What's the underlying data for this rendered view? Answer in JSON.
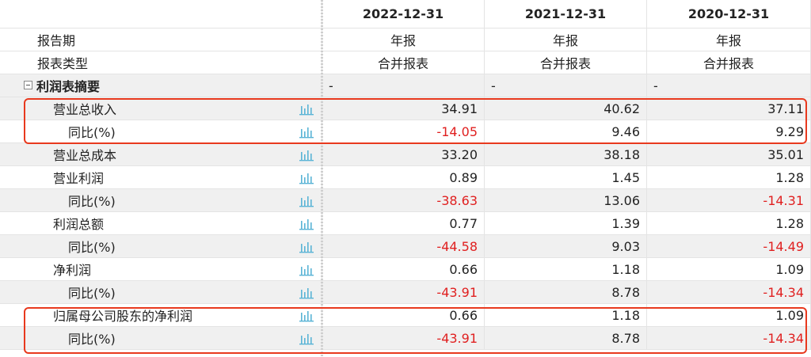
{
  "header": {
    "dates": [
      "2022-12-31",
      "2021-12-31",
      "2020-12-31"
    ]
  },
  "rows": [
    {
      "label": "报告期",
      "values": [
        "年报",
        "年报",
        "年报"
      ]
    },
    {
      "label": "报表类型",
      "values": [
        "合并报表",
        "合并报表",
        "合并报表"
      ]
    },
    {
      "label": "利润表摘要",
      "values": [
        "-",
        "-",
        "-"
      ]
    },
    {
      "label": "营业总收入",
      "values": [
        "34.91",
        "40.62",
        "37.11"
      ]
    },
    {
      "label": "同比(%)",
      "values": [
        "-14.05",
        "9.46",
        "9.29"
      ]
    },
    {
      "label": "营业总成本",
      "values": [
        "33.20",
        "38.18",
        "35.01"
      ]
    },
    {
      "label": "营业利润",
      "values": [
        "0.89",
        "1.45",
        "1.28"
      ]
    },
    {
      "label": "同比(%)",
      "values": [
        "-38.63",
        "13.06",
        "-14.31"
      ]
    },
    {
      "label": "利润总额",
      "values": [
        "0.77",
        "1.39",
        "1.28"
      ]
    },
    {
      "label": "同比(%)",
      "values": [
        "-44.58",
        "9.03",
        "-14.49"
      ]
    },
    {
      "label": "净利润",
      "values": [
        "0.66",
        "1.18",
        "1.09"
      ]
    },
    {
      "label": "同比(%)",
      "values": [
        "-43.91",
        "8.78",
        "-14.34"
      ]
    },
    {
      "label": "归属母公司股东的净利润",
      "values": [
        "0.66",
        "1.18",
        "1.09"
      ]
    },
    {
      "label": "同比(%)",
      "values": [
        "-43.91",
        "8.78",
        "-14.34"
      ]
    }
  ],
  "colors": {
    "negative": "#e02020",
    "highlight_border": "#e8391e",
    "chart_icon": "#5ab4d6"
  },
  "icons": {
    "row_chart": "bar-chart-icon",
    "section_toggle": "collapse-minus-icon"
  }
}
